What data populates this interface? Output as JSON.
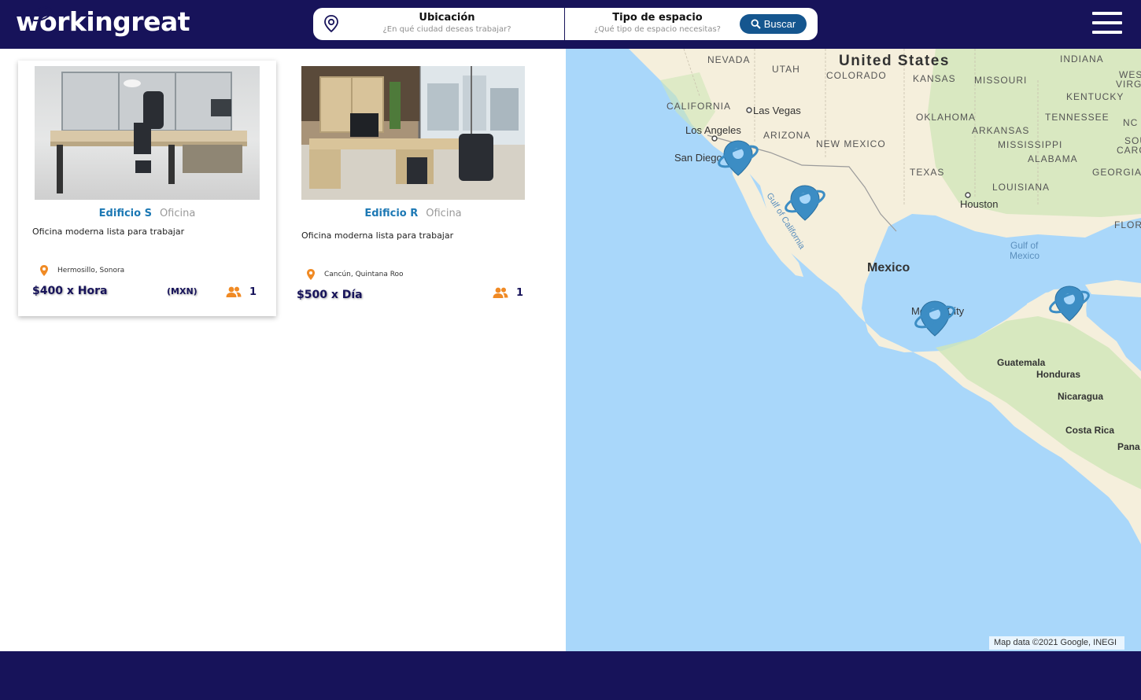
{
  "header": {
    "logo_text": "workingreat",
    "search": {
      "location_title": "Ubicación",
      "location_placeholder": "¿En qué ciudad deseas trabajar?",
      "type_title": "Tipo de espacio",
      "type_placeholder": "¿Qué tipo de espacio necesitas?",
      "button_label": "Buscar"
    }
  },
  "listings": [
    {
      "name": "Edificio S",
      "type": "Oficina",
      "description": "Oficina moderna lista para trabajar",
      "location": "Hermosillo, Sonora",
      "price": "$400  x Hora",
      "currency": "(MXN)",
      "capacity": "1"
    },
    {
      "name": "Edificio R",
      "type": "Oficina",
      "description": "Oficina moderna lista para trabajar",
      "location": "Cancún, Quintana Roo",
      "price": "$500 x Día",
      "capacity": "1"
    }
  ],
  "map": {
    "attribution": "Map data ©2021 Google, INEGI",
    "labels": {
      "nevada": "NEVADA",
      "utah": "UTAH",
      "united_states": "United States",
      "colorado": "COLORADO",
      "kansas": "KANSAS",
      "missouri": "MISSOURI",
      "indiana": "INDIANA",
      "west_virginia_1": "WEST",
      "west_virginia_2": "VIRGINI",
      "kentucky": "KENTUCKY",
      "california": "CALIFORNIA",
      "las_vegas": "Las Vegas",
      "los_angeles": "Los Angeles",
      "arizona": "ARIZONA",
      "oklahoma": "OKLAHOMA",
      "arkansas": "ARKANSAS",
      "tennessee": "TENNESSEE",
      "nc": "NC",
      "new_mexico": "NEW MEXICO",
      "san_diego": "San Diego",
      "mississippi": "MISSISSIPPI",
      "alabama": "ALABAMA",
      "south_carolina_1": "SOUTH",
      "south_carolina_2": "CAROLI",
      "texas": "TEXAS",
      "georgia": "GEORGIA",
      "louisiana": "LOUISIANA",
      "houston": "Houston",
      "florida": "FLORID",
      "gulf_of_california": "Gulf of California",
      "gulf_of_mexico_1": "Gulf of",
      "gulf_of_mexico_2": "Mexico",
      "mexico": "Mexico",
      "mexico_city": "Mexico City",
      "guatemala": "Guatemala",
      "honduras": "Honduras",
      "nicaragua": "Nicaragua",
      "costa_rica": "Costa Rica",
      "panama": "Pana"
    }
  },
  "colors": {
    "navy": "#17135a",
    "brand_blue": "#1c78b4",
    "button_blue": "#15568f",
    "accent_orange": "#f08a24",
    "marker_blue": "#3c8dc4",
    "water": "#a9d7fa",
    "land": "#f5efdc",
    "vegetation": "#cfe6b8"
  },
  "icons": [
    "location-pin-icon",
    "search-icon",
    "menu-icon",
    "map-pin-icon",
    "people-icon",
    "planet-marker-icon"
  ]
}
